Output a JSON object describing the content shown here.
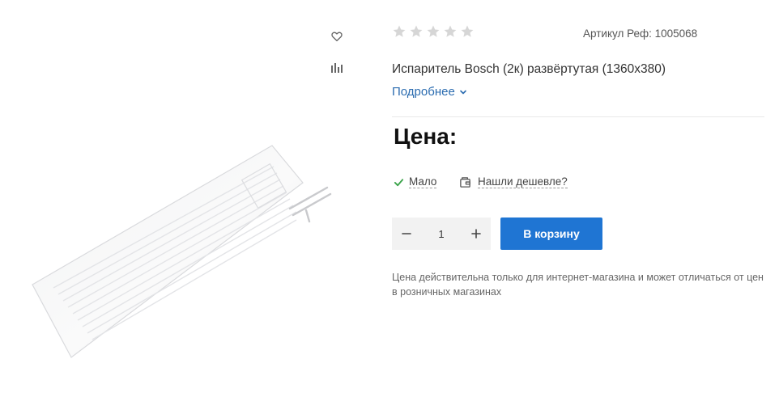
{
  "product": {
    "title": "Испаритель Bosch (2к) развёртутая (1360х380)",
    "sku_label": "Артикул Реф: 1005068",
    "rating_stars": 0,
    "rating_max": 5,
    "more_link": "Подробнее",
    "price_label": "Цена:",
    "stock_label": "Мало",
    "cheaper_label": "Нашли дешевле?",
    "quantity": "1",
    "add_to_cart": "В корзину",
    "price_note": "Цена действительна только для интернет-магазина и может отличаться от цен в розничных магазинах"
  },
  "icons": {
    "favorite": "heart-icon",
    "compare": "bar-chart-icon",
    "chevron": "chevron-down-icon",
    "stock": "check-icon",
    "cheaper": "wallet-icon",
    "minus": "minus-icon",
    "plus": "plus-icon"
  },
  "colors": {
    "accent": "#1f75d3",
    "link": "#2b6cb0",
    "check": "#3aa34a",
    "star": "#d6d6d6"
  }
}
